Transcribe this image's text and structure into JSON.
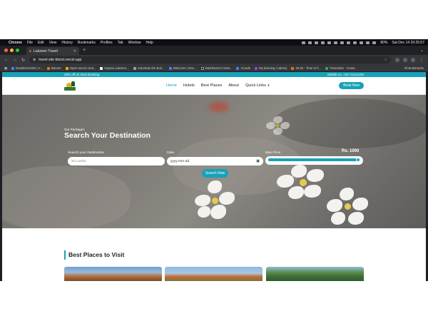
{
  "mac_menubar": {
    "app": "Chrome",
    "items": [
      "File",
      "Edit",
      "View",
      "History",
      "Bookmarks",
      "Profiles",
      "Tab",
      "Window",
      "Help"
    ],
    "battery": "80%",
    "clock": "Sat Dec 14 20:25:57"
  },
  "browser": {
    "tab_title": "Lakzeen Travel",
    "url": "travel-site-blond.vercel.app",
    "bookmarks": [
      "DealsforHotels | A...",
      "Banner",
      "Open-source tool...",
      "Kajuna Lakzeen...",
      "Automate the Bori...",
      "Welcome | Dee...",
      "Dashboard | Hack...",
      "Arcade",
      "My learning | Udemy",
      "20:30 - Time to fi...",
      "Timeshare - Custo..."
    ],
    "all_bookmarks": "All Bookmarks"
  },
  "site": {
    "promo_text": "25% off on Next Booking",
    "mobile_text": "Mobile no. +94 71412182",
    "nav": [
      "Home",
      "Hotels",
      "Best Places",
      "About",
      "Quick Links"
    ],
    "book_now": "Book Now"
  },
  "hero": {
    "subtitle": "Our Packages",
    "title": "Search Your Destination",
    "destination_label": "Search your Destination",
    "destination_placeholder": "Sri Lanka",
    "date_label": "Date",
    "date_placeholder": "yyyy-mm-dd",
    "price_label": "Max Price",
    "price_value": "Rs. 1000",
    "price_slider_fraction": 1.0,
    "search_button": "Search Now"
  },
  "best_places": {
    "title": "Best Places to Visit"
  },
  "colors": {
    "accent": "#17a2b8"
  },
  "icons": [
    "apple-icon",
    "back-icon",
    "forward-icon",
    "reload-icon",
    "star-icon",
    "calendar-icon",
    "chevron-down-icon"
  ]
}
